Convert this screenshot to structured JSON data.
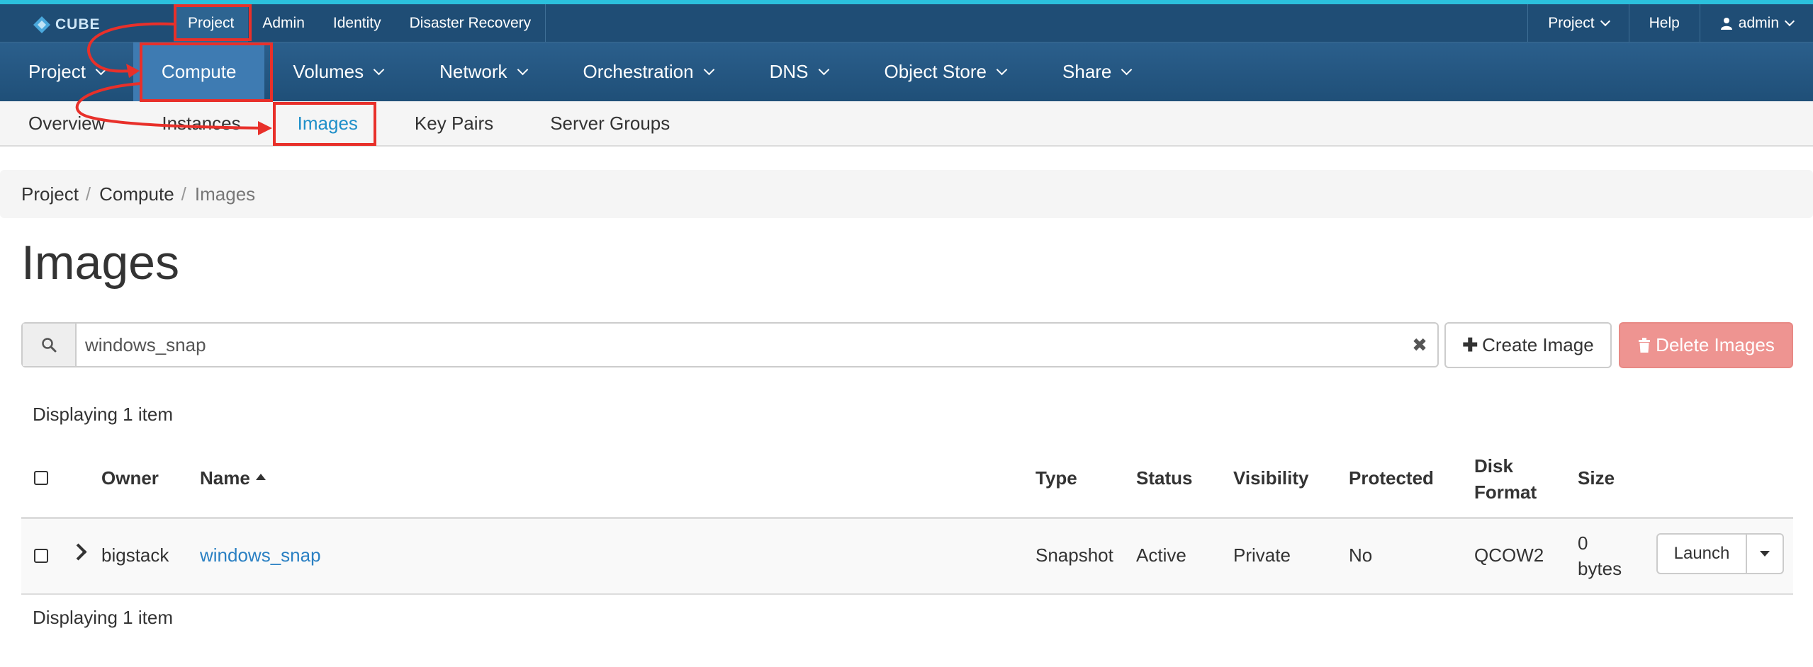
{
  "topbar": {
    "logo_text": "CUBE",
    "nav": [
      "Project",
      "Admin",
      "Identity",
      "Disaster Recovery"
    ],
    "right": {
      "project_label": "Project",
      "help_label": "Help",
      "user_label": "admin"
    }
  },
  "mainnav": [
    "Project",
    "Compute",
    "Volumes",
    "Network",
    "Orchestration",
    "DNS",
    "Object Store",
    "Share"
  ],
  "subnav": [
    "Overview",
    "Instances",
    "Images",
    "Key Pairs",
    "Server Groups"
  ],
  "breadcrumb": [
    "Project",
    "Compute",
    "Images"
  ],
  "breadcrumb_separator": "/",
  "page_title": "Images",
  "search": {
    "value": "windows_snap"
  },
  "buttons": {
    "create": "Create Image",
    "delete": "Delete Images"
  },
  "display_count": "Displaying 1 item",
  "table": {
    "headers": {
      "owner": "Owner",
      "name": "Name",
      "type": "Type",
      "status": "Status",
      "visibility": "Visibility",
      "protected": "Protected",
      "disk_format_line1": "Disk",
      "disk_format_line2": "Format",
      "size": "Size"
    },
    "rows": [
      {
        "owner": "bigstack",
        "name": "windows_snap",
        "type": "Snapshot",
        "status": "Active",
        "visibility": "Private",
        "protected": "No",
        "disk_format": "QCOW2",
        "size_line1": "0",
        "size_line2": "bytes",
        "action": "Launch"
      }
    ]
  },
  "colors": {
    "topbar": "#1f4d75",
    "accent_strip": "#2bc0dd",
    "active_nav": "#3e7bb2",
    "link": "#2a80c3",
    "danger_button": "#ee9491",
    "annotation": "#e8302a"
  }
}
